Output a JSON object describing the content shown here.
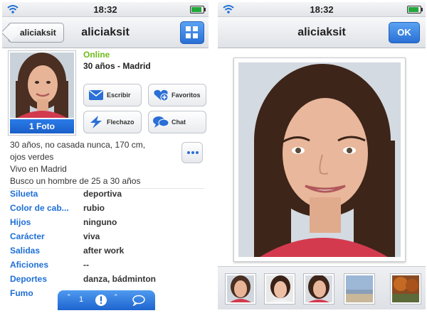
{
  "left_screen": {
    "status": {
      "time": "18:32"
    },
    "nav": {
      "back_label": "aliciaksit",
      "title": "aliciaksit"
    },
    "profile": {
      "photo_count": "1 Foto",
      "online": "Online",
      "age_city": "30 años - Madrid",
      "actions": [
        {
          "label": "Escribir",
          "icon": "envelope-icon"
        },
        {
          "label": "Favoritos",
          "icon": "heart-plus-icon"
        },
        {
          "label": "Flechazo",
          "icon": "lightning-icon"
        },
        {
          "label": "Chat",
          "icon": "speech-bubbles-icon"
        }
      ],
      "description": [
        "30 años, no casada nunca, 170 cm,",
        "ojos verdes",
        "Vivo en Madrid",
        "Busco un hombre de 25 a 30 años"
      ],
      "attributes": [
        {
          "key": "Silueta",
          "value": "deportiva"
        },
        {
          "key": "Color de cab...",
          "value": "rubio"
        },
        {
          "key": "Hijos",
          "value": "ninguno"
        },
        {
          "key": "Carácter",
          "value": "viva"
        },
        {
          "key": "Salidas",
          "value": "after work"
        },
        {
          "key": "Aficiones",
          "value": "--"
        },
        {
          "key": "Deportes",
          "value": "danza, bádminton"
        },
        {
          "key": "Fumo",
          "value": ""
        }
      ]
    },
    "tabbar": {
      "count": "1"
    }
  },
  "right_screen": {
    "status": {
      "time": "18:32"
    },
    "nav": {
      "title": "aliciaksit",
      "ok_label": "OK"
    }
  },
  "colors": {
    "accent_blue": "#1e6fd6",
    "online_green": "#6dbb1a"
  }
}
